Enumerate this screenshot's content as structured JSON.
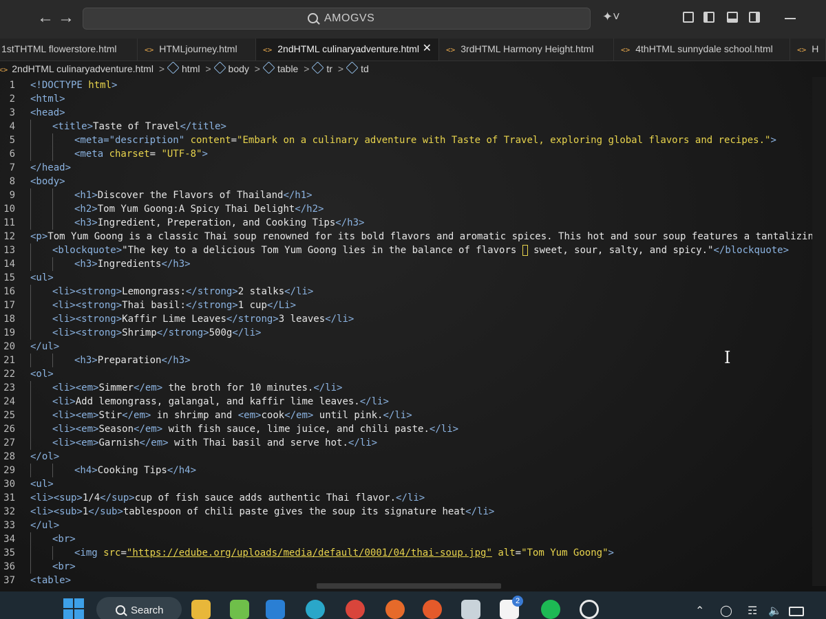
{
  "titlebar": {
    "search_text": "AMOGVS"
  },
  "tabs": [
    {
      "label": "1stTHTML flowerstore.html"
    },
    {
      "label": "HTMLjourney.html"
    },
    {
      "label": "2ndHTML culinaryadventure.html"
    },
    {
      "label": "3rdHTML Harmony Height.html"
    },
    {
      "label": "4thHTML sunnydale school.html"
    },
    {
      "label": "H"
    }
  ],
  "breadcrumb": {
    "file": "2ndHTML culinaryadventure.html",
    "items": [
      "html",
      "body",
      "table",
      "tr",
      "td"
    ]
  },
  "editor": {
    "lines": [
      {
        "n": "1",
        "indent": 0,
        "tokens": [
          [
            "tg",
            "<!DOCTYPE "
          ],
          [
            "at",
            "html"
          ],
          [
            "tg",
            ">"
          ]
        ]
      },
      {
        "n": "2",
        "indent": 0,
        "tokens": [
          [
            "tg",
            "<html>"
          ]
        ]
      },
      {
        "n": "3",
        "indent": 0,
        "tokens": [
          [
            "tg",
            "<head>"
          ]
        ]
      },
      {
        "n": "4",
        "indent": 1,
        "tokens": [
          [
            "tg",
            "<title>"
          ],
          [
            "tx",
            "Taste of Travel"
          ],
          [
            "tg",
            "</title>"
          ]
        ]
      },
      {
        "n": "5",
        "indent": 2,
        "tokens": [
          [
            "tg",
            "<meta=\"description\" "
          ],
          [
            "at",
            "content"
          ],
          [
            "tx",
            "="
          ],
          [
            "st",
            "\"Embark on a culinary adventure with Taste of Travel, exploring global flavors and recipes.\""
          ],
          [
            "tg",
            ">"
          ]
        ]
      },
      {
        "n": "6",
        "indent": 2,
        "tokens": [
          [
            "tg",
            "<meta "
          ],
          [
            "at",
            "charset"
          ],
          [
            "tx",
            "= "
          ],
          [
            "st",
            "\"UTF-8\""
          ],
          [
            "tg",
            ">"
          ]
        ]
      },
      {
        "n": "7",
        "indent": 0,
        "tokens": [
          [
            "tg",
            "</head>"
          ]
        ]
      },
      {
        "n": "8",
        "indent": 0,
        "tokens": [
          [
            "tg",
            "<body>"
          ]
        ]
      },
      {
        "n": "9",
        "indent": 2,
        "tokens": [
          [
            "tg",
            "<h1>"
          ],
          [
            "tx",
            "Discover the Flavors of Thailand"
          ],
          [
            "tg",
            "</h1>"
          ]
        ]
      },
      {
        "n": "10",
        "indent": 2,
        "tokens": [
          [
            "tg",
            "<h2>"
          ],
          [
            "tx",
            "Tom Yum Goong:A Spicy Thai Delight"
          ],
          [
            "tg",
            "</h2>"
          ]
        ]
      },
      {
        "n": "11",
        "indent": 2,
        "tokens": [
          [
            "tg",
            "<h3>"
          ],
          [
            "tx",
            "Ingredient, Preperation, and Cooking Tips"
          ],
          [
            "tg",
            "</h3>"
          ]
        ]
      },
      {
        "n": "12",
        "indent": 0,
        "tokens": [
          [
            "tg",
            "<p>"
          ],
          [
            "tx",
            "Tom Yum Goong is a classic Thai soup renowned for its bold flavors and aromatic spices. This hot and sour soup features a tantalizing ble"
          ]
        ]
      },
      {
        "n": "13",
        "indent": 1,
        "tokens": [
          [
            "tg",
            "<blockquote>"
          ],
          [
            "tx",
            "\"The key to a delicious Tom Yum Goong lies in the balance of flavors "
          ],
          [
            "box",
            ""
          ],
          [
            "tx",
            " sweet, sour, salty, and spicy.\""
          ],
          [
            "tg",
            "</blockquote>"
          ]
        ]
      },
      {
        "n": "14",
        "indent": 2,
        "tokens": [
          [
            "tg",
            "<h3>"
          ],
          [
            "tx",
            "Ingredients"
          ],
          [
            "tg",
            "</h3>"
          ]
        ]
      },
      {
        "n": "15",
        "indent": 0,
        "tokens": [
          [
            "tg",
            "<ul>"
          ]
        ]
      },
      {
        "n": "16",
        "indent": 1,
        "tokens": [
          [
            "tg",
            "<li><strong>"
          ],
          [
            "tx",
            "Lemongrass:"
          ],
          [
            "tg",
            "</strong>"
          ],
          [
            "tx",
            "2 stalks"
          ],
          [
            "tg",
            "</li>"
          ]
        ]
      },
      {
        "n": "17",
        "indent": 1,
        "tokens": [
          [
            "tg",
            "<li><strong>"
          ],
          [
            "tx",
            "Thai basil:"
          ],
          [
            "tg",
            "</strong>"
          ],
          [
            "tx",
            "1 cup"
          ],
          [
            "tg",
            "</Li>"
          ]
        ]
      },
      {
        "n": "18",
        "indent": 1,
        "tokens": [
          [
            "tg",
            "<li><strong>"
          ],
          [
            "tx",
            "Kaffir Lime Leaves"
          ],
          [
            "tg",
            "</strong>"
          ],
          [
            "tx",
            "3 leaves"
          ],
          [
            "tg",
            "</li>"
          ]
        ]
      },
      {
        "n": "19",
        "indent": 1,
        "tokens": [
          [
            "tg",
            "<li><strong>"
          ],
          [
            "tx",
            "Shrimp"
          ],
          [
            "tg",
            "</strong>"
          ],
          [
            "tx",
            "500g"
          ],
          [
            "tg",
            "</li>"
          ]
        ]
      },
      {
        "n": "20",
        "indent": 0,
        "tokens": [
          [
            "tg",
            "</ul>"
          ]
        ]
      },
      {
        "n": "21",
        "indent": 2,
        "tokens": [
          [
            "tg",
            "<h3>"
          ],
          [
            "tx",
            "Preparation"
          ],
          [
            "tg",
            "</h3>"
          ]
        ]
      },
      {
        "n": "22",
        "indent": 0,
        "tokens": [
          [
            "tg",
            "<ol>"
          ]
        ]
      },
      {
        "n": "23",
        "indent": 1,
        "tokens": [
          [
            "tg",
            "<li><em>"
          ],
          [
            "tx",
            "Simmer"
          ],
          [
            "tg",
            "</em>"
          ],
          [
            "tx",
            " the broth for 10 minutes."
          ],
          [
            "tg",
            "</li>"
          ]
        ]
      },
      {
        "n": "24",
        "indent": 1,
        "tokens": [
          [
            "tg",
            "<li>"
          ],
          [
            "tx",
            "Add lemongrass, galangal, and kaffir lime leaves."
          ],
          [
            "tg",
            "</li>"
          ]
        ]
      },
      {
        "n": "25",
        "indent": 1,
        "tokens": [
          [
            "tg",
            "<li><em>"
          ],
          [
            "tx",
            "Stir"
          ],
          [
            "tg",
            "</em>"
          ],
          [
            "tx",
            " in shrimp and "
          ],
          [
            "tg",
            "<em>"
          ],
          [
            "tx",
            "cook"
          ],
          [
            "tg",
            "</em>"
          ],
          [
            "tx",
            " until pink."
          ],
          [
            "tg",
            "</li>"
          ]
        ]
      },
      {
        "n": "26",
        "indent": 1,
        "tokens": [
          [
            "tg",
            "<li><em>"
          ],
          [
            "tx",
            "Season"
          ],
          [
            "tg",
            "</em>"
          ],
          [
            "tx",
            " with fish sauce, lime juice, and chili paste."
          ],
          [
            "tg",
            "</li>"
          ]
        ]
      },
      {
        "n": "27",
        "indent": 1,
        "tokens": [
          [
            "tg",
            "<li><em>"
          ],
          [
            "tx",
            "Garnish"
          ],
          [
            "tg",
            "</em>"
          ],
          [
            "tx",
            " with Thai basil and serve hot."
          ],
          [
            "tg",
            "</li>"
          ]
        ]
      },
      {
        "n": "28",
        "indent": 0,
        "tokens": [
          [
            "tg",
            "</ol>"
          ]
        ]
      },
      {
        "n": "29",
        "indent": 2,
        "tokens": [
          [
            "tg",
            "<h4>"
          ],
          [
            "tx",
            "Cooking Tips"
          ],
          [
            "tg",
            "</h4>"
          ]
        ]
      },
      {
        "n": "30",
        "indent": 0,
        "tokens": [
          [
            "tg",
            "<ul>"
          ]
        ]
      },
      {
        "n": "31",
        "indent": 0,
        "tokens": [
          [
            "tg",
            "<li><sup>"
          ],
          [
            "tx",
            "1/4"
          ],
          [
            "tg",
            "</sup>"
          ],
          [
            "tx",
            "cup of fish sauce adds authentic Thai flavor."
          ],
          [
            "tg",
            "</li>"
          ]
        ]
      },
      {
        "n": "32",
        "indent": 0,
        "tokens": [
          [
            "tg",
            "<li><sub>"
          ],
          [
            "tx",
            "1"
          ],
          [
            "tg",
            "</sub>"
          ],
          [
            "tx",
            "tablespoon of chili paste gives the soup its signature heat"
          ],
          [
            "tg",
            "</li>"
          ]
        ]
      },
      {
        "n": "33",
        "indent": 0,
        "tokens": [
          [
            "tg",
            "</ul>"
          ]
        ]
      },
      {
        "n": "34",
        "indent": 1,
        "tokens": [
          [
            "tg",
            "<br>"
          ]
        ]
      },
      {
        "n": "35",
        "indent": 2,
        "tokens": [
          [
            "tg",
            "<img "
          ],
          [
            "at",
            "src"
          ],
          [
            "tx",
            "="
          ],
          [
            "url",
            "\"https://edube.org/uploads/media/default/0001/04/thai-soup.jpg\""
          ],
          [
            "tx",
            " "
          ],
          [
            "at",
            "alt"
          ],
          [
            "tx",
            "="
          ],
          [
            "st",
            "\"Tom Yum Goong\""
          ],
          [
            "tg",
            ">"
          ]
        ]
      },
      {
        "n": "36",
        "indent": 1,
        "tokens": [
          [
            "tg",
            "<br>"
          ]
        ]
      },
      {
        "n": "37",
        "indent": 0,
        "tokens": [
          [
            "tg",
            "<table>"
          ]
        ]
      }
    ]
  },
  "taskbar": {
    "search_label": "Search",
    "badge_count": "2"
  },
  "colors": {
    "tag": "#8cb4e2",
    "attr": "#e8d44d",
    "text": "#e6e6e6",
    "tab_icon": "#e8a84c"
  }
}
